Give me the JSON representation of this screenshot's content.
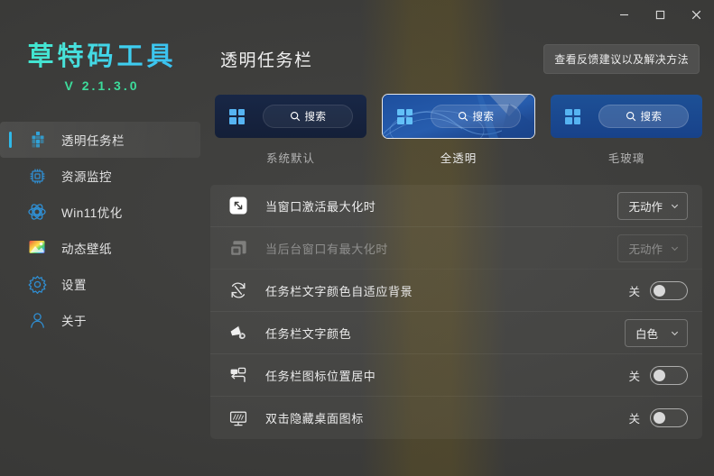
{
  "window": {
    "minimize_label": "最小化",
    "maximize_label": "最大化",
    "close_label": "关闭"
  },
  "brand": {
    "title": "草特码工具",
    "version": "V 2.1.3.0",
    "accent": "#37e8c8",
    "version_color": "#3ddc9b"
  },
  "sidebar": {
    "items": [
      {
        "label": "透明任务栏",
        "icon": "taskbar-icon",
        "active": true
      },
      {
        "label": "资源监控",
        "icon": "cpu-monitor-icon",
        "active": false
      },
      {
        "label": "Win11优化",
        "icon": "atom-optimize-icon",
        "active": false
      },
      {
        "label": "动态壁纸",
        "icon": "wallpaper-icon",
        "active": false
      },
      {
        "label": "设置",
        "icon": "gear-icon",
        "active": false
      },
      {
        "label": "关于",
        "icon": "person-icon",
        "active": false
      }
    ]
  },
  "header": {
    "title": "透明任务栏",
    "feedback_button": "查看反馈建议以及解决方法"
  },
  "cards": [
    {
      "caption": "系统默认",
      "search_label": "搜索",
      "style": "default",
      "selected": false
    },
    {
      "caption": "全透明",
      "search_label": "搜索",
      "style": "trans",
      "selected": true
    },
    {
      "caption": "毛玻璃",
      "search_label": "搜索",
      "style": "glass",
      "selected": false
    }
  ],
  "settings": {
    "rows": [
      {
        "label": "当窗口激活最大化时",
        "icon": "maximize-window-icon",
        "control": "dropdown",
        "value": "无动作",
        "disabled": false
      },
      {
        "label": "当后台窗口有最大化时",
        "icon": "background-window-icon",
        "control": "dropdown",
        "value": "无动作",
        "disabled": true
      },
      {
        "label": "任务栏文字颜色自适应背景",
        "icon": "auto-refresh-icon",
        "control": "toggle",
        "value": "关",
        "on": false,
        "disabled": false
      },
      {
        "label": "任务栏文字颜色",
        "icon": "paint-palette-icon",
        "control": "dropdown",
        "value": "白色",
        "disabled": false
      },
      {
        "label": "任务栏图标位置居中",
        "icon": "align-center-icon",
        "control": "toggle",
        "value": "关",
        "on": false,
        "disabled": false
      },
      {
        "label": "双击隐藏桌面图标",
        "icon": "desktop-monitor-icon",
        "control": "toggle",
        "value": "关",
        "on": false,
        "disabled": false
      }
    ]
  }
}
